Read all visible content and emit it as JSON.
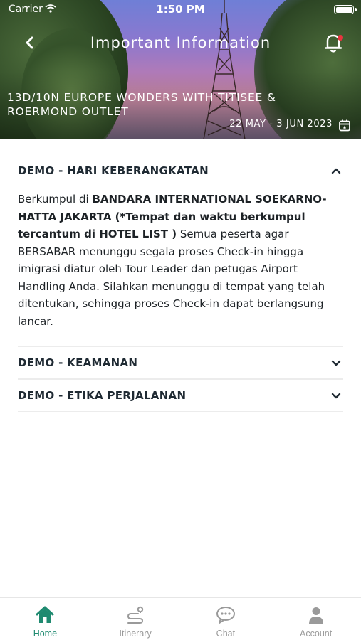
{
  "status_bar": {
    "carrier": "Carrier",
    "time": "1:50 PM"
  },
  "header": {
    "title": "Important Information",
    "trip_title": "13D/10N EUROPE WONDERS WITH TITISEE & ROERMOND OUTLET",
    "trip_dates": "22 MAY - 3 JUN 2023"
  },
  "accordion": [
    {
      "title": "DEMO - HARI KEBERANGKATAN",
      "expanded": true,
      "body": {
        "t1": "Berkumpul di ",
        "b1": "BANDARA INTERNATIONAL SOEKARNO-HATTA JAKARTA (*Tempat dan waktu berkumpul tercantum di HOTEL LIST )",
        "t2": " Semua peserta agar BERSABAR menunggu segala proses Check-in hingga imigrasi diatur oleh Tour Leader dan petugas Airport Handling Anda. Silahkan menunggu di tempat yang telah ditentukan, sehingga proses Check-in dapat berlangsung lancar."
      }
    },
    {
      "title": "DEMO - KEAMANAN",
      "expanded": false
    },
    {
      "title": "DEMO - ETIKA PERJALANAN",
      "expanded": false
    }
  ],
  "tabbar": [
    {
      "label": "Home",
      "icon": "home-icon",
      "active": true
    },
    {
      "label": "Itinerary",
      "icon": "route-icon",
      "active": false
    },
    {
      "label": "Chat",
      "icon": "chat-icon",
      "active": false
    },
    {
      "label": "Account",
      "icon": "user-icon",
      "active": false
    }
  ],
  "colors": {
    "accent": "#1f8a70",
    "inactive": "#9a9a9a",
    "notification_dot": "#e8343f"
  }
}
